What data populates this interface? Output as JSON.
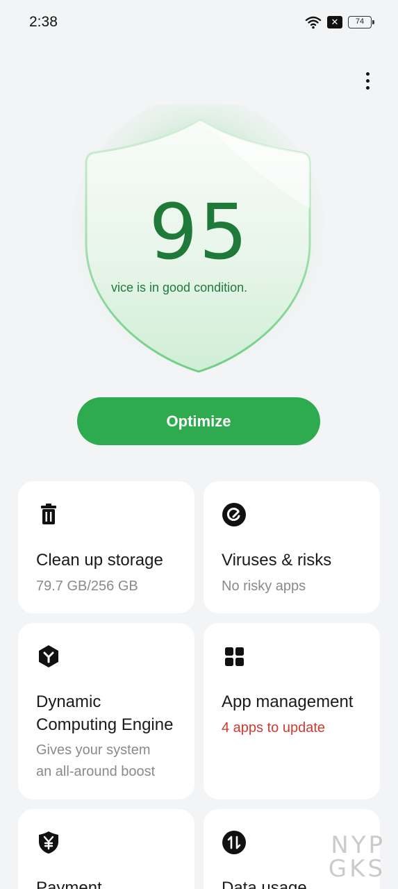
{
  "status": {
    "time": "2:38",
    "battery": "74"
  },
  "shield": {
    "score": "95",
    "message": "vice is in good condition."
  },
  "optimize_label": "Optimize",
  "cards": [
    {
      "title": "Clean up storage",
      "subtitle": "79.7 GB/256 GB",
      "icon": "trash-icon"
    },
    {
      "title": "Viruses & risks",
      "subtitle": "No risky apps",
      "icon": "virus-scan-icon"
    },
    {
      "title": "Dynamic Computing Engine",
      "title_line1": "Dynamic",
      "title_line2": "Computing Engine",
      "subtitle_line1": "Gives your system",
      "subtitle_line2": "an all-around boost",
      "icon": "engine-icon"
    },
    {
      "title": "App management",
      "subtitle": "4 apps to update",
      "subtitle_color": "#d03a2f",
      "icon": "app-grid-icon"
    },
    {
      "title": "Payment",
      "icon": "payment-shield-icon"
    },
    {
      "title": "Data usage",
      "icon": "data-usage-icon"
    }
  ],
  "watermark": {
    "line1": "NYP",
    "line2": "GKS"
  },
  "colors": {
    "accent": "#2eab4e",
    "score": "#1f7a3a",
    "background": "#f3f4f6",
    "alert": "#d03a2f"
  }
}
